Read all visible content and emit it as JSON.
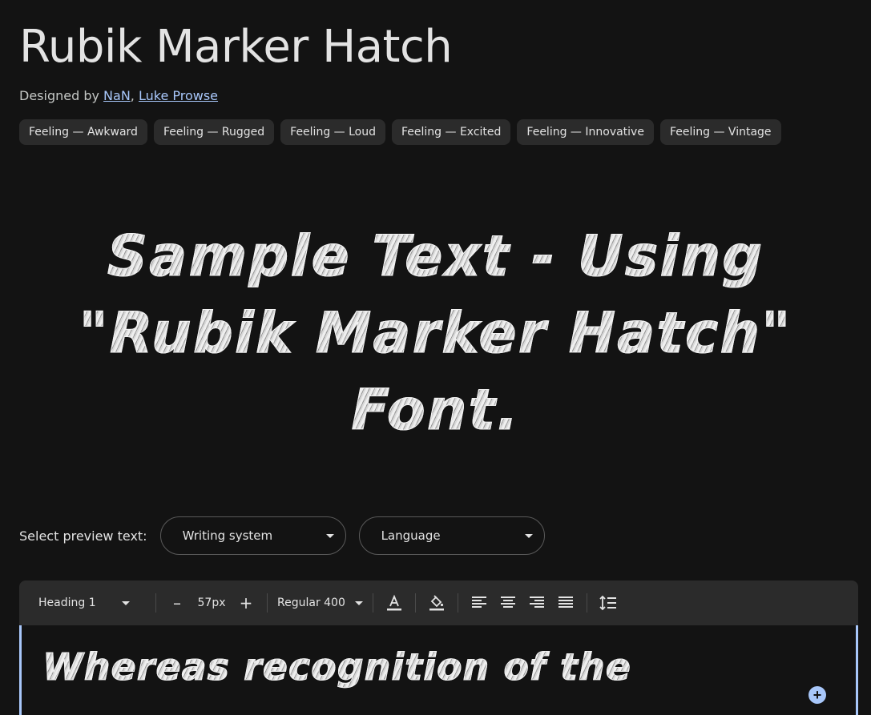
{
  "font": {
    "title": "Rubik Marker Hatch",
    "designed_by_prefix": "Designed by ",
    "designer_separator": ", ",
    "designers": [
      "NaN",
      "Luke Prowse"
    ]
  },
  "tags": [
    "Feeling — Awkward",
    "Feeling — Rugged",
    "Feeling — Loud",
    "Feeling — Excited",
    "Feeling — Innovative",
    "Feeling — Vintage"
  ],
  "hero_sample": {
    "line1": "Sample Text - Using",
    "line2": "\"Rubik Marker Hatch\"",
    "line3": "Font."
  },
  "preview": {
    "label": "Select preview text:",
    "writing_system": "Writing system",
    "language": "Language"
  },
  "toolbar": {
    "style": "Heading 1",
    "minus": "–",
    "size": "57px",
    "plus": "+",
    "weight": "Regular 400"
  },
  "editor": {
    "text": "Whereas recognition of the"
  },
  "colors": {
    "background": "#131313",
    "link": "#a8c7fa",
    "chip": "#2b2b2b",
    "accent": "#a8c7fa"
  }
}
